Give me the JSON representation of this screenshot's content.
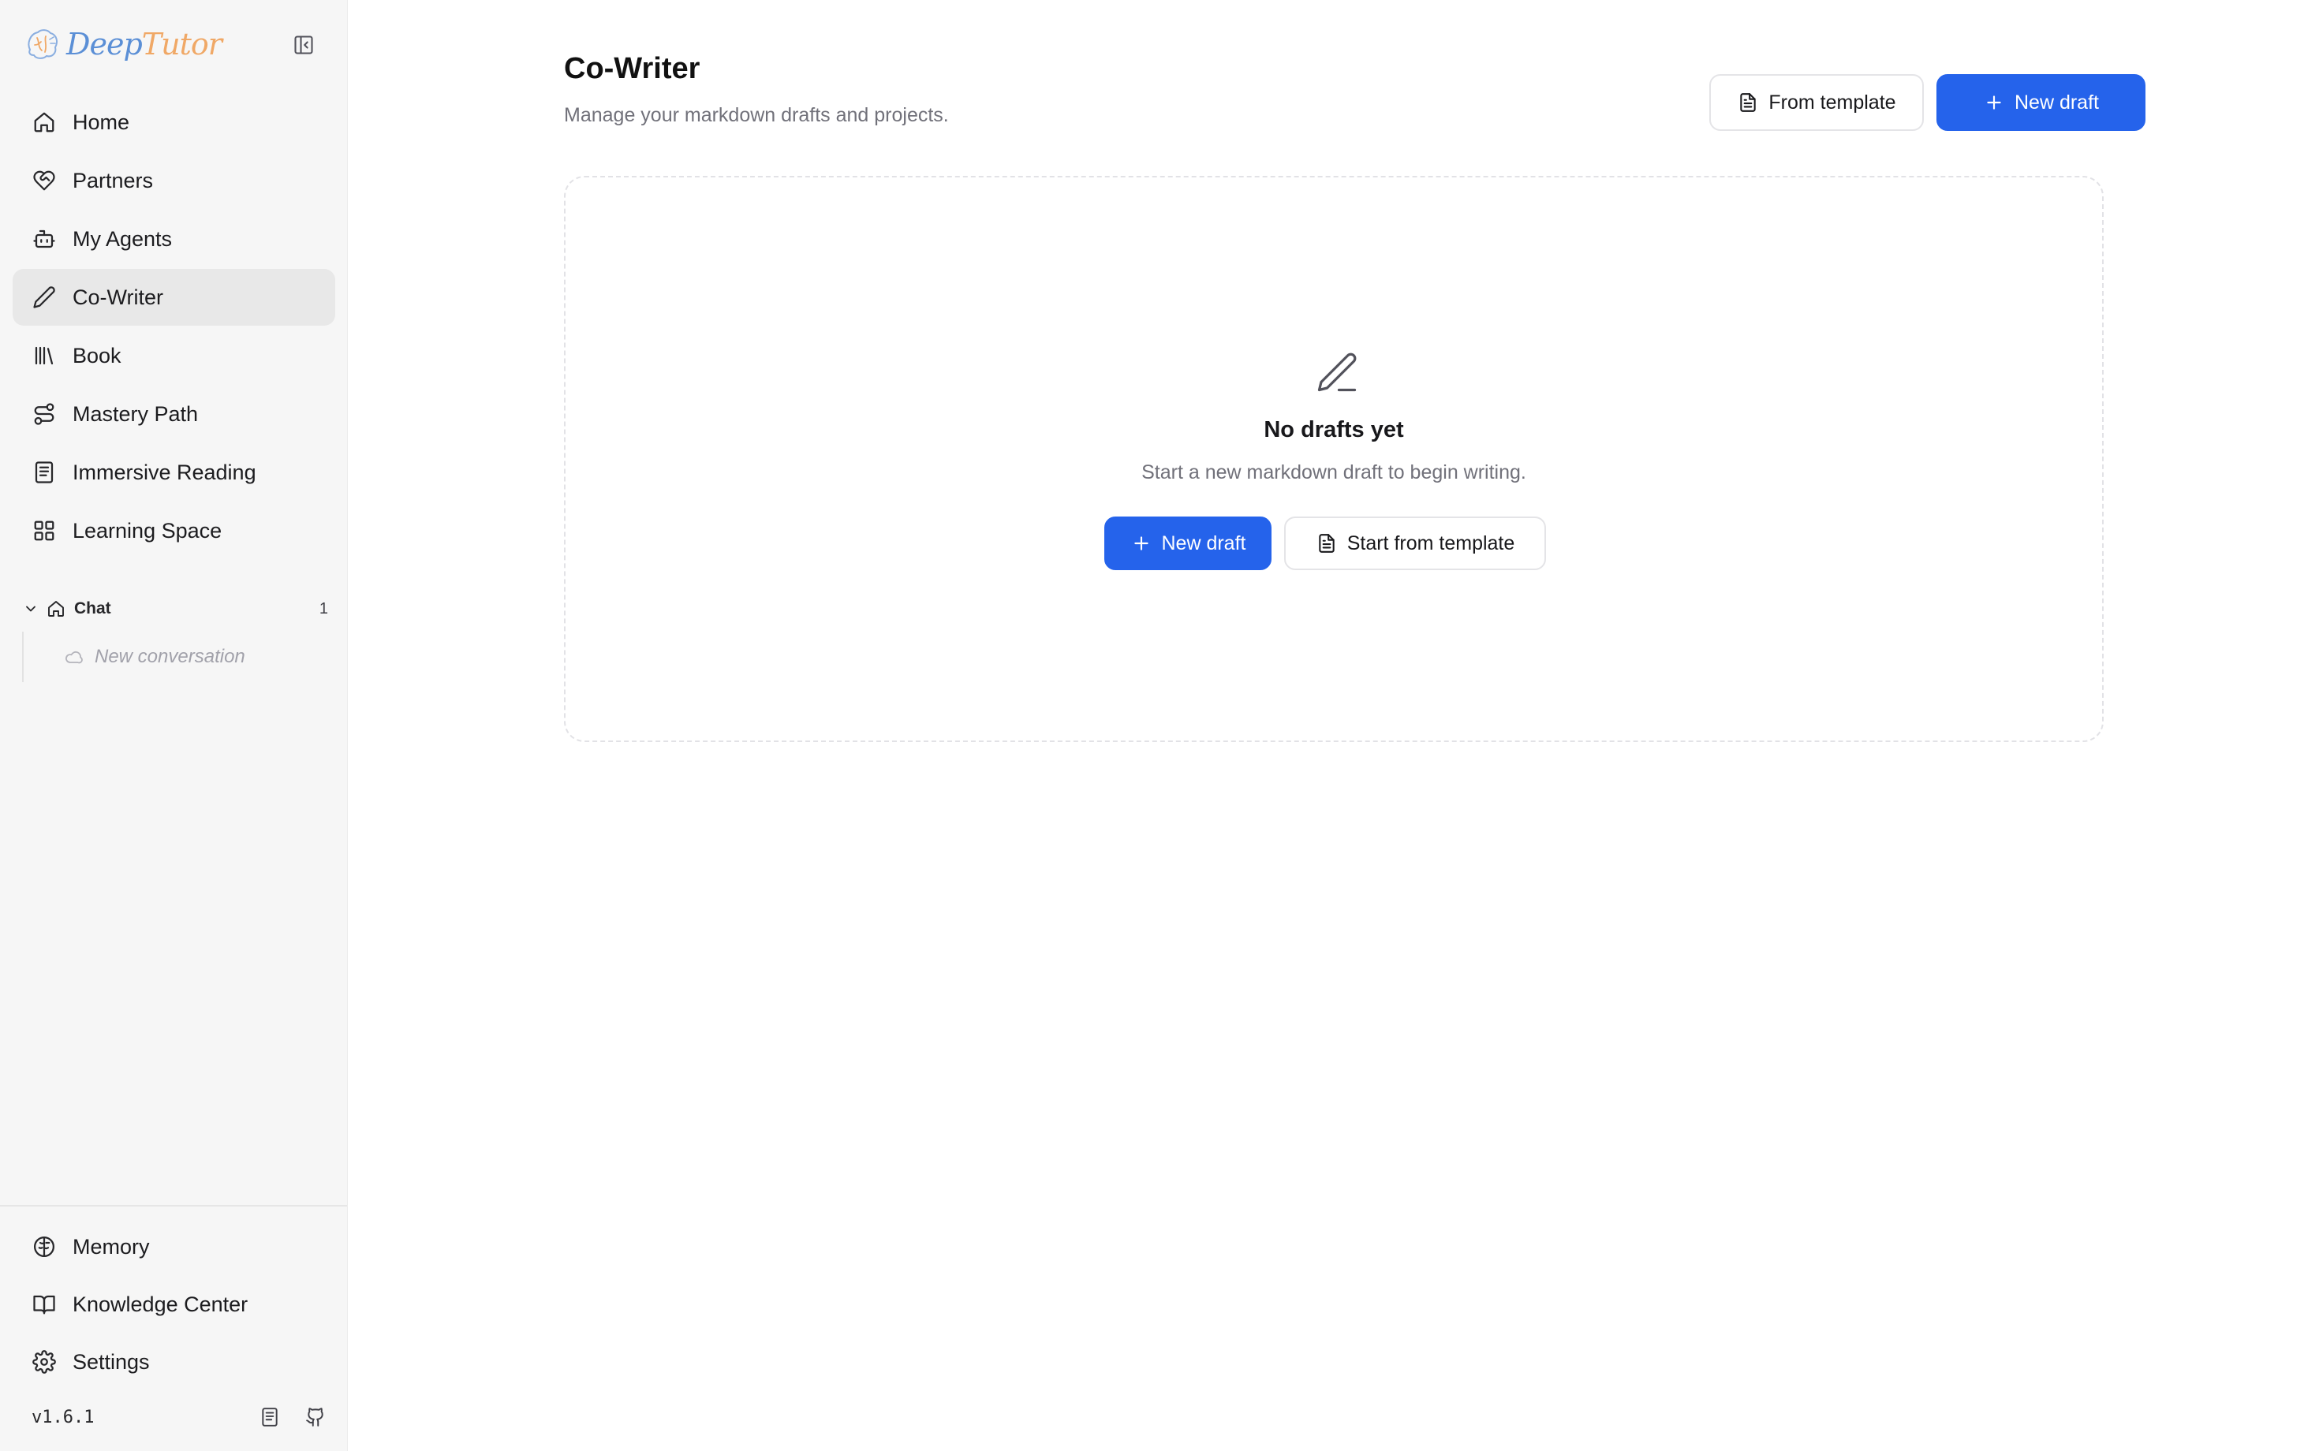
{
  "brand": {
    "name_part1": "Deep",
    "name_part2": "Tutor"
  },
  "sidebar": {
    "nav": [
      {
        "label": "Home",
        "icon": "home-icon"
      },
      {
        "label": "Partners",
        "icon": "heart-handshake-icon"
      },
      {
        "label": "My Agents",
        "icon": "bot-icon"
      },
      {
        "label": "Co-Writer",
        "icon": "pen-icon",
        "active": true
      },
      {
        "label": "Book",
        "icon": "library-icon"
      },
      {
        "label": "Mastery Path",
        "icon": "route-icon"
      },
      {
        "label": "Immersive Reading",
        "icon": "reader-icon"
      },
      {
        "label": "Learning Space",
        "icon": "grid-icon"
      }
    ],
    "chat": {
      "label": "Chat",
      "count": "1",
      "conversations": [
        {
          "label": "New conversation"
        }
      ]
    },
    "bottom": [
      {
        "label": "Memory",
        "icon": "brain-icon"
      },
      {
        "label": "Knowledge Center",
        "icon": "book-open-icon"
      },
      {
        "label": "Settings",
        "icon": "gear-icon"
      }
    ],
    "version": "v1.6.1"
  },
  "main": {
    "title": "Co-Writer",
    "subtitle": "Manage your markdown drafts and projects.",
    "from_template_label": "From template",
    "new_draft_label": "New draft",
    "empty": {
      "title": "No drafts yet",
      "subtitle": "Start a new markdown draft to begin writing.",
      "new_draft_label": "New draft",
      "start_template_label": "Start from template"
    }
  },
  "colors": {
    "accent": "#2563eb",
    "sidebar_bg": "#f6f6f6",
    "active_item_bg": "#e8e8e8",
    "muted_text": "#71717a"
  }
}
